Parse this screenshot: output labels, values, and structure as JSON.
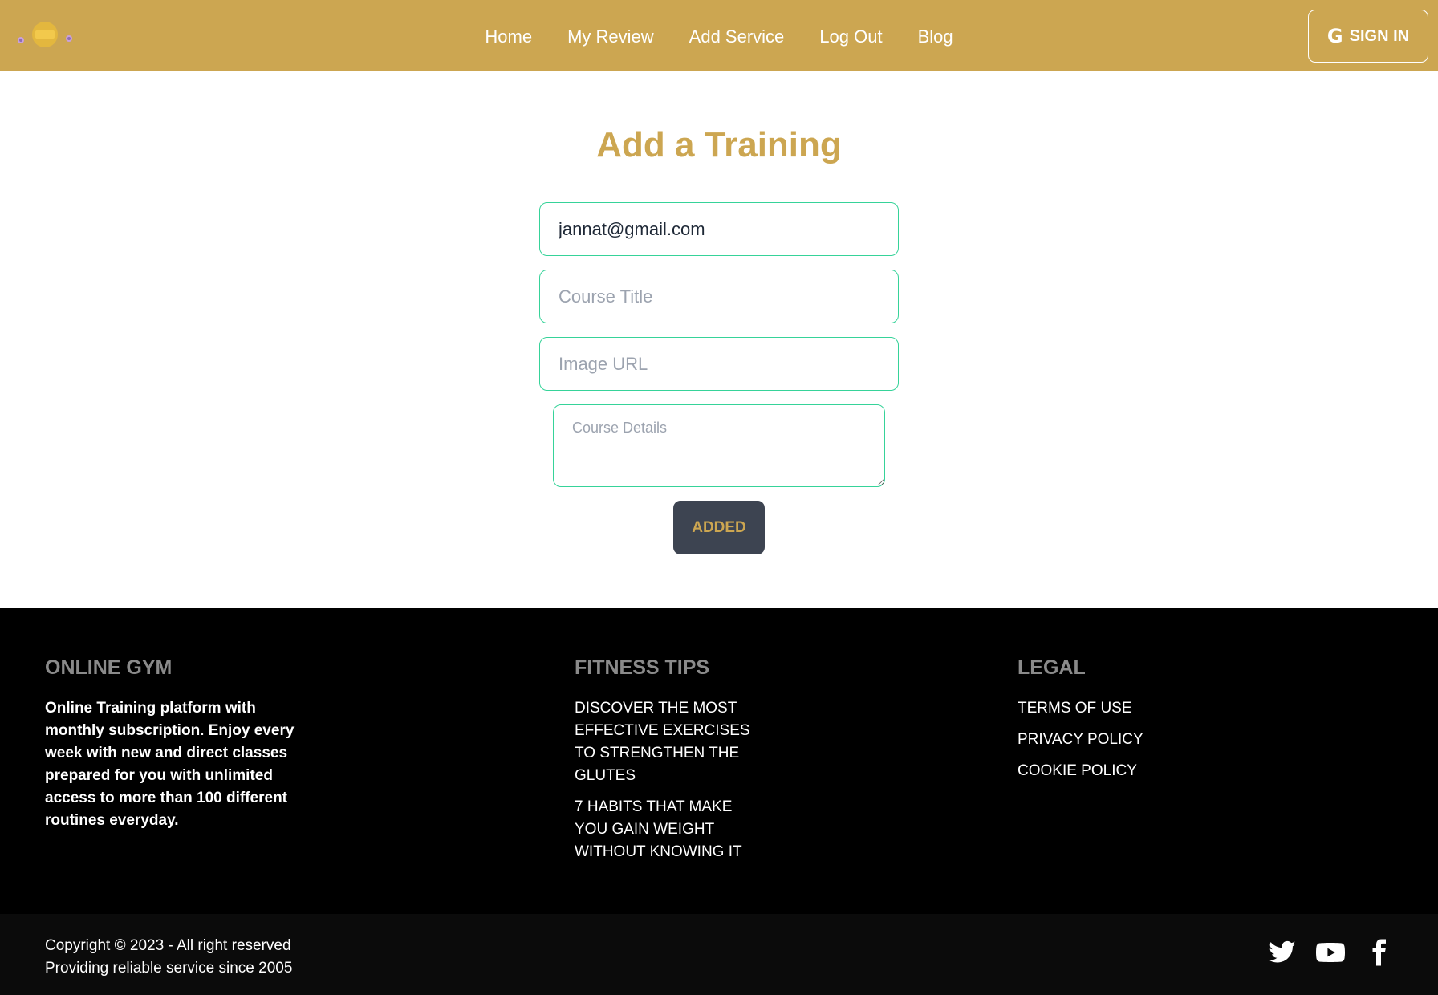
{
  "navbar": {
    "links": [
      "Home",
      "My Review",
      "Add Service",
      "Log Out",
      "Blog"
    ],
    "signin_label": "SIGN IN",
    "brand_color": "#CCA651"
  },
  "form": {
    "title": "Add a Training",
    "email_value": "jannat@gmail.com",
    "course_title_placeholder": "Course Title",
    "image_url_placeholder": "Image URL",
    "details_placeholder": "Course Details",
    "submit_label": "ADDED",
    "field_border_color": "#36D399"
  },
  "footer": {
    "col1": {
      "heading": "ONLINE GYM",
      "text": "Online Training platform with monthly subscription. Enjoy every week with new and direct classes prepared for you with unlimited access to more than 100 different routines everyday."
    },
    "col2": {
      "heading": "FITNESS TIPS",
      "links": [
        "DISCOVER THE MOST EFFECTIVE EXERCISES TO STRENGTHEN THE GLUTES",
        "7 HABITS THAT MAKE YOU GAIN WEIGHT WITHOUT KNOWING IT"
      ]
    },
    "col3": {
      "heading": "LEGAL",
      "links": [
        "TERMS OF USE",
        "PRIVACY POLICY",
        "COOKIE POLICY"
      ]
    },
    "copyright_line1": "Copyright © 2023 - All right reserved",
    "copyright_line2": "Providing reliable service since 2005",
    "social_icons": [
      "twitter-icon",
      "youtube-icon",
      "facebook-icon"
    ]
  }
}
